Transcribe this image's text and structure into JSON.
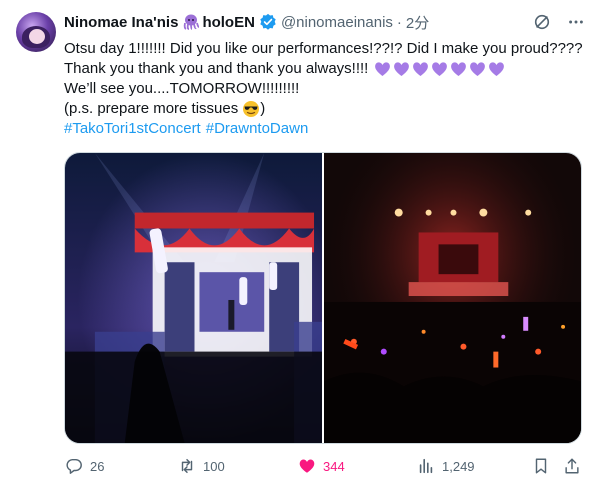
{
  "author": {
    "display_name": "Ninomae Ina'nis",
    "org": "holoEN",
    "handle": "@ninomaeinanis",
    "separator": "·",
    "time": "2分"
  },
  "tweet": {
    "line1": "Otsu day 1!!!!!!! Did you like our performances!??!? Did I make you proud????",
    "line2": "Thank you thank you and thank you always!!!!",
    "line3": "We’ll see you....TOMORROW!!!!!!!!!",
    "line4_prefix": "(p.s. prepare more tissues",
    "line4_suffix": ")",
    "hashtag1": "#TakoTori1stConcert",
    "hashtag2": "#DrawntoDawn",
    "hearts_count": 7
  },
  "icons": {
    "octopus": "octopus-emoji",
    "verified": "verified-badge-icon",
    "grok": "grok-icon",
    "more": "more-icon",
    "reply": "reply-icon",
    "retweet": "retweet-icon",
    "like": "heart-icon",
    "views": "views-icon",
    "bookmark": "bookmark-icon",
    "share": "share-icon"
  },
  "actions": {
    "replies": "26",
    "retweets": "100",
    "likes": "344",
    "views": "1,249"
  },
  "colors": {
    "accent": "#1d9bf0",
    "like": "#f91880",
    "muted": "#536471",
    "heart_purple": "#a57be6"
  }
}
